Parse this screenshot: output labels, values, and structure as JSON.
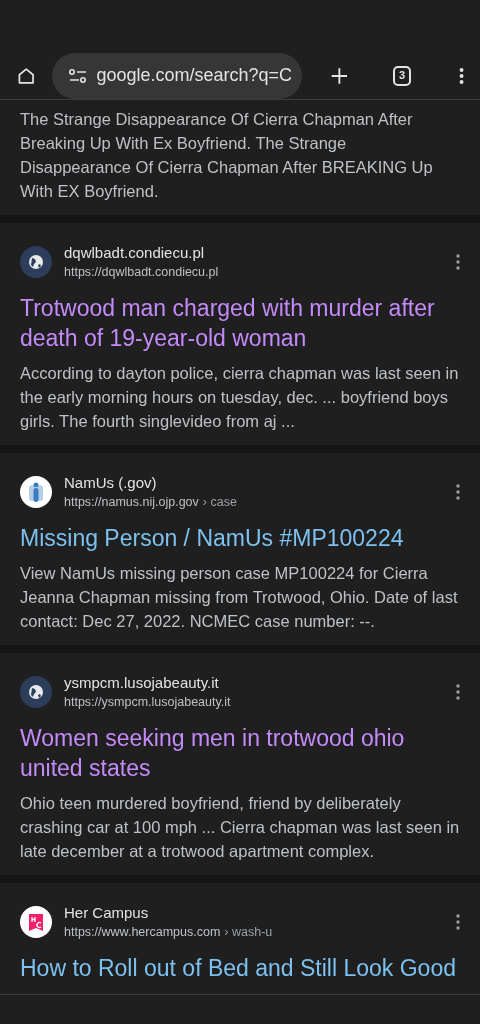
{
  "toolbar": {
    "address": "google.com/search?q=C",
    "tab_count": "3"
  },
  "top_snippet": "The Strange Disappearance Of Cierra Chapman After Breaking Up With Ex Boyfriend. The Strange Disappearance Of Cierra Chapman After BREAKING Up With EX Boyfriend.",
  "results": [
    {
      "kind": "globe",
      "site": "dqwlbadt.condiecu.pl",
      "url": "https://dqwlbadt.condiecu.pl",
      "title": "Trotwood man charged with murder after death of 19-year-old woman",
      "visited": true,
      "snippet": "According to dayton police, cierra chapman was last seen in the early morning hours on tuesday, dec. ... boyfriend boys girls. The fourth singlevideo from aj ..."
    },
    {
      "kind": "figure",
      "site": "NamUs (.gov)",
      "url": "https://namus.nij.ojp.gov",
      "path": "› case",
      "title": "Missing Person / NamUs #MP100224",
      "visited": false,
      "snippet": "View NamUs missing person case MP100224 for Cierra Jeanna Chapman missing from Trotwood, Ohio. Date of last contact: Dec 27, 2022. NCMEC case number: --."
    },
    {
      "kind": "globe",
      "site": "ysmpcm.lusojabeauty.it",
      "url": "https://ysmpcm.lusojabeauty.it",
      "title": "Women seeking men in trotwood ohio united states",
      "visited": true,
      "snippet": "Ohio teen murdered boyfriend, friend by deliberately crashing car at 100 mph ... Cierra chapman was last seen in late december at a trotwood apartment complex."
    },
    {
      "kind": "monogram",
      "site": "Her Campus",
      "url": "https://www.hercampus.com",
      "path": "› wash-u",
      "title": "How to Roll out of Bed and Still Look Good",
      "visited": false
    }
  ]
}
